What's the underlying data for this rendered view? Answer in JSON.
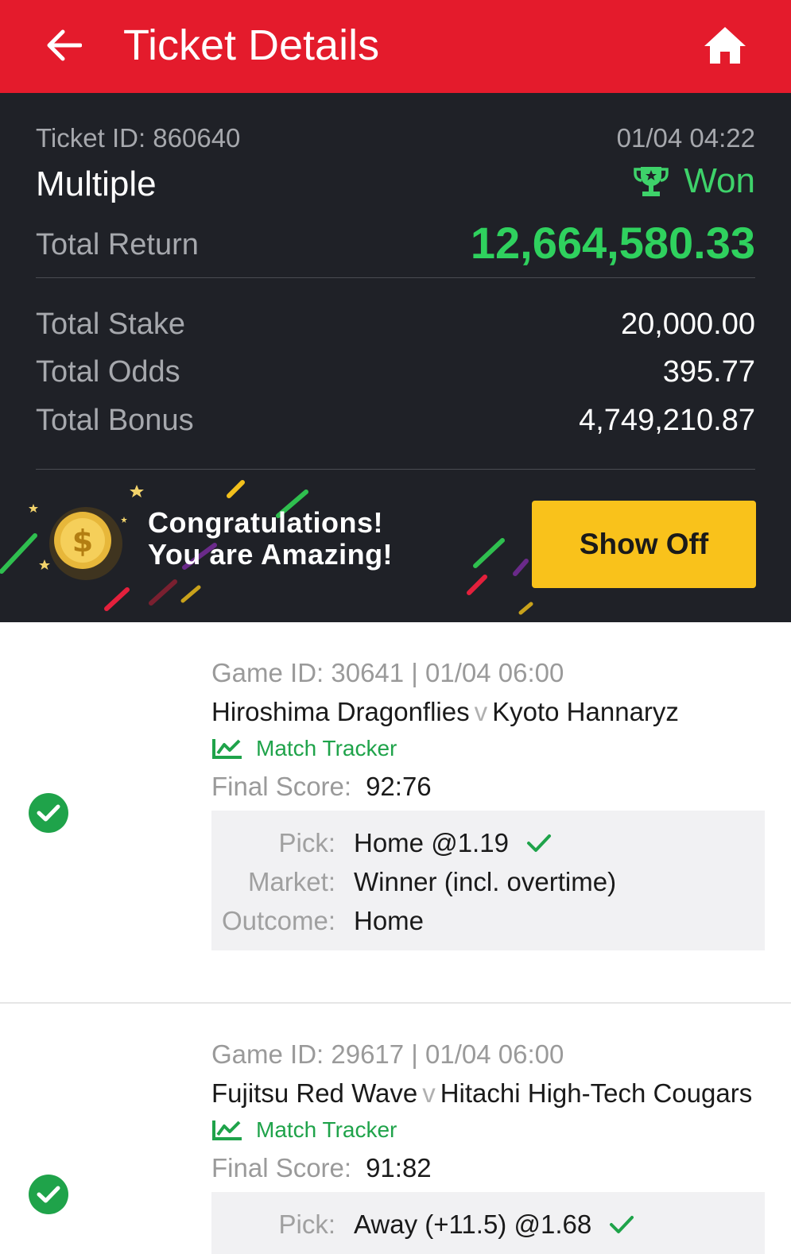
{
  "header": {
    "title": "Ticket Details"
  },
  "ticket": {
    "id_label": "Ticket ID: 860640",
    "datetime": "01/04 04:22",
    "type": "Multiple",
    "status": "Won",
    "total_return_label": "Total Return",
    "total_return": "12,664,580.33",
    "total_stake_label": "Total Stake",
    "total_stake": "20,000.00",
    "total_odds_label": "Total Odds",
    "total_odds": "395.77",
    "total_bonus_label": "Total Bonus",
    "total_bonus": "4,749,210.87"
  },
  "banner": {
    "line1": "Congratulations!",
    "line2": "You are Amazing!",
    "button": "Show Off"
  },
  "games": [
    {
      "game_id": "Game ID: 30641 | 01/04 06:00",
      "home": "Hiroshima Dragonflies",
      "vs": "v",
      "away": "Kyoto Hannaryz",
      "tracker": "Match Tracker",
      "final_label": "Final Score:",
      "final_score": "92:76",
      "pick_label": "Pick:",
      "pick": "Home @1.19",
      "market_label": "Market:",
      "market": "Winner (incl. overtime)",
      "outcome_label": "Outcome:",
      "outcome": "Home"
    },
    {
      "game_id": "Game ID: 29617 | 01/04 06:00",
      "home": "Fujitsu Red Wave",
      "vs": "v",
      "away": "Hitachi High-Tech Cougars",
      "tracker": "Match Tracker",
      "final_label": "Final Score:",
      "final_score": "91:82",
      "pick_label": "Pick:",
      "pick": "Away (+11.5) @1.68"
    }
  ],
  "colors": {
    "header_red": "#e41b2c",
    "dark_bg": "#1f2127",
    "win_green": "#2fd15e",
    "button_yellow": "#f9c21b",
    "tracker_green": "#1fa34a"
  },
  "icons": {
    "back": "arrow-left-icon",
    "home": "home-icon",
    "trophy": "trophy-icon",
    "coin": "coin-icon",
    "tracker": "chart-line-icon",
    "check": "check-circle-icon"
  }
}
